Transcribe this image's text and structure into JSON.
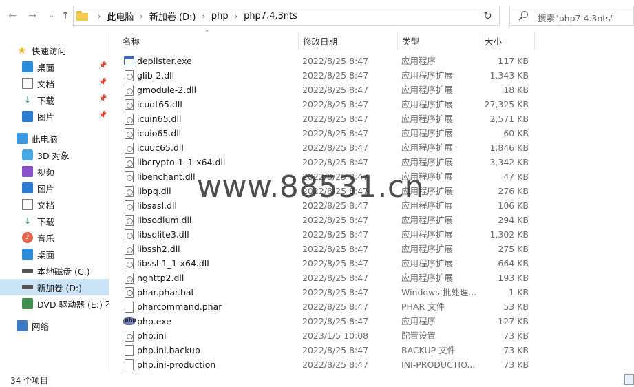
{
  "toolbar": {
    "back_icon": "arrow-left-icon",
    "forward_icon": "arrow-right-icon",
    "recent_icon": "chevron-down-icon",
    "up_icon": "arrow-up-icon"
  },
  "address": {
    "crumbs": [
      "此电脑",
      "新加卷 (D:)",
      "php",
      "php7.4.3nts"
    ]
  },
  "search": {
    "placeholder": "搜索\"php7.4.3nts\""
  },
  "nav": {
    "quick_access": "快速访问",
    "quick_items": [
      "桌面",
      "文档",
      "下载",
      "图片"
    ],
    "this_pc": "此电脑",
    "pc_items": [
      "3D 对象",
      "视频",
      "图片",
      "文档",
      "下载",
      "音乐",
      "桌面",
      "本地磁盘 (C:)",
      "新加卷 (D:)",
      "DVD 驱动器 (E:) 不"
    ],
    "network": "网络",
    "selected": "新加卷 (D:)"
  },
  "columns": {
    "name": "名称",
    "date": "修改日期",
    "type": "类型",
    "size": "大小"
  },
  "files": [
    {
      "name": "deplister.exe",
      "date": "2022/8/25 8:47",
      "type": "应用程序",
      "size": "117 KB",
      "icon": "exe"
    },
    {
      "name": "glib-2.dll",
      "date": "2022/8/25 8:47",
      "type": "应用程序扩展",
      "size": "1,343 KB",
      "icon": "dll"
    },
    {
      "name": "gmodule-2.dll",
      "date": "2022/8/25 8:47",
      "type": "应用程序扩展",
      "size": "18 KB",
      "icon": "dll"
    },
    {
      "name": "icudt65.dll",
      "date": "2022/8/25 8:47",
      "type": "应用程序扩展",
      "size": "27,325 KB",
      "icon": "dll"
    },
    {
      "name": "icuin65.dll",
      "date": "2022/8/25 8:47",
      "type": "应用程序扩展",
      "size": "2,571 KB",
      "icon": "dll"
    },
    {
      "name": "icuio65.dll",
      "date": "2022/8/25 8:47",
      "type": "应用程序扩展",
      "size": "60 KB",
      "icon": "dll"
    },
    {
      "name": "icuuc65.dll",
      "date": "2022/8/25 8:47",
      "type": "应用程序扩展",
      "size": "1,846 KB",
      "icon": "dll"
    },
    {
      "name": "libcrypto-1_1-x64.dll",
      "date": "2022/8/25 8:47",
      "type": "应用程序扩展",
      "size": "3,342 KB",
      "icon": "dll"
    },
    {
      "name": "libenchant.dll",
      "date": "2022/8/25 8:47",
      "type": "应用程序扩展",
      "size": "47 KB",
      "icon": "dll"
    },
    {
      "name": "libpq.dll",
      "date": "2022/8/25 8:47",
      "type": "应用程序扩展",
      "size": "276 KB",
      "icon": "dll"
    },
    {
      "name": "libsasl.dll",
      "date": "2022/8/25 8:47",
      "type": "应用程序扩展",
      "size": "106 KB",
      "icon": "dll"
    },
    {
      "name": "libsodium.dll",
      "date": "2022/8/25 8:47",
      "type": "应用程序扩展",
      "size": "294 KB",
      "icon": "dll"
    },
    {
      "name": "libsqlite3.dll",
      "date": "2022/8/25 8:47",
      "type": "应用程序扩展",
      "size": "1,302 KB",
      "icon": "dll"
    },
    {
      "name": "libssh2.dll",
      "date": "2022/8/25 8:47",
      "type": "应用程序扩展",
      "size": "275 KB",
      "icon": "dll"
    },
    {
      "name": "libssl-1_1-x64.dll",
      "date": "2022/8/25 8:47",
      "type": "应用程序扩展",
      "size": "664 KB",
      "icon": "dll"
    },
    {
      "name": "nghttp2.dll",
      "date": "2022/8/25 8:47",
      "type": "应用程序扩展",
      "size": "193 KB",
      "icon": "dll"
    },
    {
      "name": "phar.phar.bat",
      "date": "2022/8/25 8:47",
      "type": "Windows 批处理...",
      "size": "1 KB",
      "icon": "bat"
    },
    {
      "name": "pharcommand.phar",
      "date": "2022/8/25 8:47",
      "type": "PHAR 文件",
      "size": "53 KB",
      "icon": "file"
    },
    {
      "name": "php.exe",
      "date": "2022/8/25 8:47",
      "type": "应用程序",
      "size": "127 KB",
      "icon": "php"
    },
    {
      "name": "php.ini",
      "date": "2023/1/5 10:08",
      "type": "配置设置",
      "size": "73 KB",
      "icon": "ini"
    },
    {
      "name": "php.ini.backup",
      "date": "2022/8/25 8:47",
      "type": "BACKUP 文件",
      "size": "73 KB",
      "icon": "file"
    },
    {
      "name": "php.ini-production",
      "date": "2022/8/25 8:47",
      "type": "INI-PRODUCTIO...",
      "size": "73 KB",
      "icon": "file"
    }
  ],
  "watermark": "www.88531.cn",
  "status": {
    "item_count": "34 个项目"
  }
}
